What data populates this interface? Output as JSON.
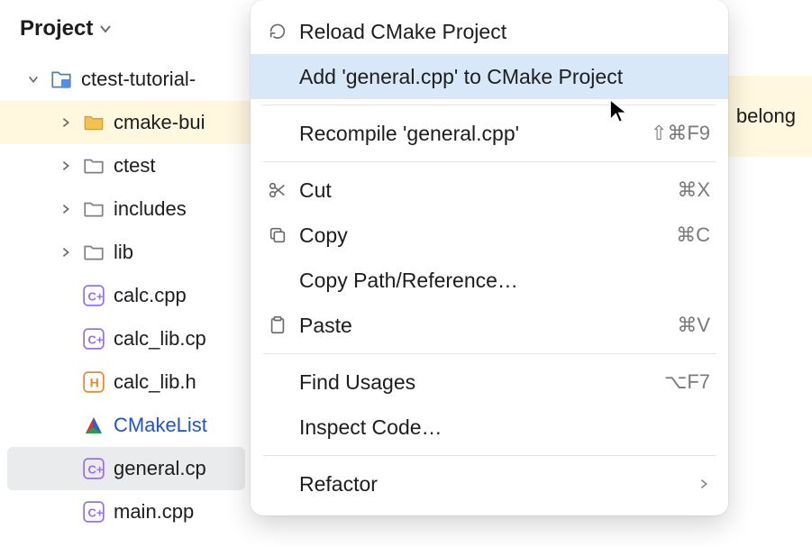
{
  "project_panel": {
    "title": "Project",
    "tree": {
      "root": {
        "label": "ctest-tutorial-"
      },
      "cmake_build": {
        "label": "cmake-bui"
      },
      "ctest": {
        "label": "ctest"
      },
      "includes": {
        "label": "includes"
      },
      "lib": {
        "label": "lib"
      },
      "calc_cpp": {
        "label": "calc.cpp"
      },
      "calc_lib_cpp": {
        "label": "calc_lib.cp"
      },
      "calc_lib_h": {
        "label": "calc_lib.h"
      },
      "cmakelists": {
        "label": "CMakeList"
      },
      "general_cpp": {
        "label": "general.cp"
      },
      "main_cpp": {
        "label": "main.cpp"
      }
    }
  },
  "editor_banner": {
    "text": "belong"
  },
  "context_menu": {
    "reload": {
      "label": "Reload CMake Project"
    },
    "add_to_cmake": {
      "label": "Add 'general.cpp' to CMake Project"
    },
    "recompile": {
      "label": "Recompile 'general.cpp'",
      "shortcut": "⇧⌘F9"
    },
    "cut": {
      "label": "Cut",
      "shortcut": "⌘X"
    },
    "copy": {
      "label": "Copy",
      "shortcut": "⌘C"
    },
    "copy_path": {
      "label": "Copy Path/Reference…"
    },
    "paste": {
      "label": "Paste",
      "shortcut": "⌘V"
    },
    "find_usages": {
      "label": "Find Usages",
      "shortcut": "⌥F7"
    },
    "inspect": {
      "label": "Inspect Code…"
    },
    "refactor": {
      "label": "Refactor"
    }
  }
}
